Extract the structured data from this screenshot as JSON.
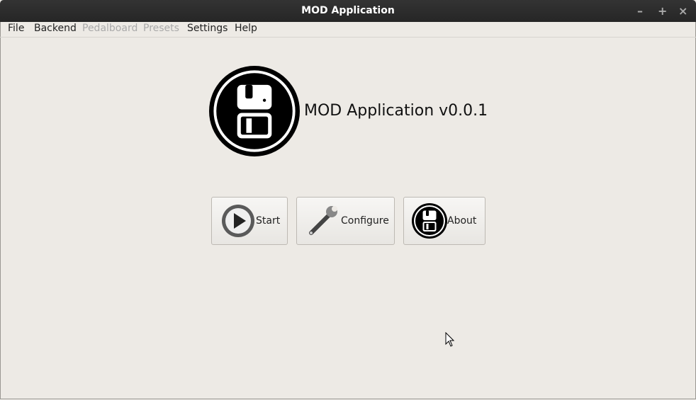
{
  "window": {
    "title": "MOD Application"
  },
  "menu": [
    {
      "label": "File",
      "enabled": true
    },
    {
      "label": "Backend",
      "enabled": true
    },
    {
      "label": "Pedalboard",
      "enabled": false
    },
    {
      "label": "Presets",
      "enabled": false
    },
    {
      "label": "Settings",
      "enabled": true
    },
    {
      "label": "Help",
      "enabled": true
    }
  ],
  "main": {
    "app_title": "MOD Application v0.0.1"
  },
  "buttons": {
    "start": "Start",
    "configure": "Configure",
    "about": "About"
  }
}
